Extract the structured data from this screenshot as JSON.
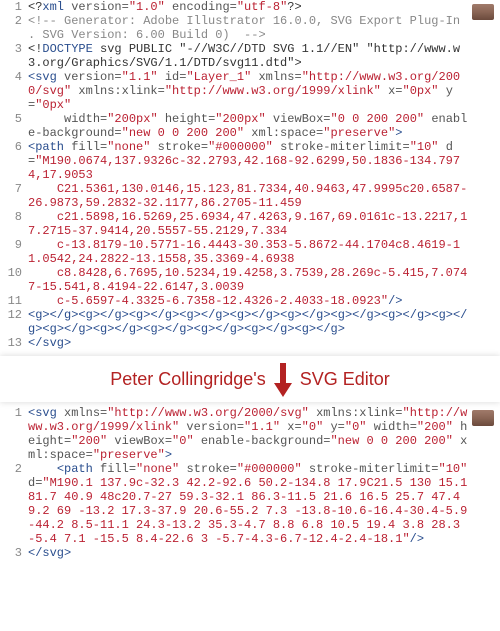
{
  "top": {
    "lines": [
      {
        "n": 1,
        "seg": [
          {
            "t": "<?",
            "c": "c-text"
          },
          {
            "t": "xml",
            "c": "c-tag"
          },
          {
            "t": " version=",
            "c": "c-attr"
          },
          {
            "t": "\"1.0\"",
            "c": "c-str"
          },
          {
            "t": " encoding=",
            "c": "c-attr"
          },
          {
            "t": "\"utf-8\"",
            "c": "c-str"
          },
          {
            "t": "?> ",
            "c": "c-text"
          }
        ]
      },
      {
        "n": 2,
        "seg": [
          {
            "t": "<!-- Generator: Adobe Illustrator 16.0.0, SVG Export Plug-In . SVG Version: 6.00 Build 0)  -->",
            "c": "c-gray"
          }
        ]
      },
      {
        "n": 3,
        "seg": [
          {
            "t": "<!",
            "c": "c-text"
          },
          {
            "t": "DOCTYPE",
            "c": "c-tag"
          },
          {
            "t": " svg PUBLIC \"-//W3C//DTD SVG 1.1//EN\" \"http://www.w3.org/Graphics/SVG/1.1/DTD/svg11.dtd\"",
            "c": "c-text"
          },
          {
            "t": ">",
            "c": "c-text"
          }
        ]
      },
      {
        "n": 4,
        "seg": [
          {
            "t": "<",
            "c": "c-tag"
          },
          {
            "t": "svg",
            "c": "c-tag"
          },
          {
            "t": " version=",
            "c": "c-attr"
          },
          {
            "t": "\"1.1\"",
            "c": "c-str"
          },
          {
            "t": " id=",
            "c": "c-attr"
          },
          {
            "t": "\"Layer_1\"",
            "c": "c-str"
          },
          {
            "t": " xmlns=",
            "c": "c-attr"
          },
          {
            "t": "\"http://www.w3.org/2000/svg\"",
            "c": "c-str"
          },
          {
            "t": " xmlns:xlink=",
            "c": "c-attr"
          },
          {
            "t": "\"http://www.w3.org/1999/xlink\"",
            "c": "c-str"
          },
          {
            "t": " x=",
            "c": "c-attr"
          },
          {
            "t": "\"0px\"",
            "c": "c-str"
          },
          {
            "t": " y=",
            "c": "c-attr"
          },
          {
            "t": "\"0px\"",
            "c": "c-str"
          }
        ]
      },
      {
        "n": 5,
        "seg": [
          {
            "t": "     width=",
            "c": "c-attr"
          },
          {
            "t": "\"200px\"",
            "c": "c-str"
          },
          {
            "t": " height=",
            "c": "c-attr"
          },
          {
            "t": "\"200px\"",
            "c": "c-str"
          },
          {
            "t": " viewBox=",
            "c": "c-attr"
          },
          {
            "t": "\"0 0 200 200\"",
            "c": "c-str"
          },
          {
            "t": " enable-background=",
            "c": "c-attr"
          },
          {
            "t": "\"new 0 0 200 200\"",
            "c": "c-str"
          },
          {
            "t": " xml:space=",
            "c": "c-attr"
          },
          {
            "t": "\"preserve\"",
            "c": "c-str"
          },
          {
            "t": ">",
            "c": "c-tag"
          }
        ]
      },
      {
        "n": 6,
        "seg": [
          {
            "t": "<",
            "c": "c-tag"
          },
          {
            "t": "path",
            "c": "c-tag"
          },
          {
            "t": " fill=",
            "c": "c-attr"
          },
          {
            "t": "\"none\"",
            "c": "c-str"
          },
          {
            "t": " stroke=",
            "c": "c-attr"
          },
          {
            "t": "\"#000000\"",
            "c": "c-str"
          },
          {
            "t": " stroke-miterlimit=",
            "c": "c-attr"
          },
          {
            "t": "\"10\"",
            "c": "c-str"
          },
          {
            "t": " d=",
            "c": "c-attr"
          },
          {
            "t": "\"M190.0674,137.9326c-32.2793,42.168-92.6299,50.1836-134.7974,17.9053",
            "c": "c-str"
          }
        ]
      },
      {
        "n": 7,
        "seg": [
          {
            "t": "    C21.5361,130.0146,15.123,81.7334,40.9463,47.9995c20.6587-26.9873,59.2832-32.1177,86.2705-11.459",
            "c": "c-str"
          }
        ]
      },
      {
        "n": 8,
        "seg": [
          {
            "t": "    c21.5898,16.5269,25.6934,47.4263,9.167,69.0161c-13.2217,17.2715-37.9414,20.5557-55.2129,7.334",
            "c": "c-str"
          }
        ]
      },
      {
        "n": 9,
        "seg": [
          {
            "t": "    c-13.8179-10.5771-16.4443-30.353-5.8672-44.1704c8.4619-11.0542,24.2822-13.1558,35.3369-4.6938",
            "c": "c-str"
          }
        ]
      },
      {
        "n": 10,
        "seg": [
          {
            "t": "    c8.8428,6.7695,10.5234,19.4258,3.7539,28.269c-5.415,7.0747-15.541,8.4194-22.6147,3.0039",
            "c": "c-str"
          }
        ]
      },
      {
        "n": 11,
        "seg": [
          {
            "t": "    c-5.6597-4.3325-6.7358-12.4326-2.4033-18.0923\"",
            "c": "c-str"
          },
          {
            "t": "/>",
            "c": "c-tag"
          }
        ]
      },
      {
        "n": 12,
        "seg": [
          {
            "t": "<",
            "c": "c-tag"
          },
          {
            "t": "g",
            "c": "c-tag"
          },
          {
            "t": "></",
            "c": "c-tag"
          },
          {
            "t": "g",
            "c": "c-tag"
          },
          {
            "t": "><",
            "c": "c-tag"
          },
          {
            "t": "g",
            "c": "c-tag"
          },
          {
            "t": "></",
            "c": "c-tag"
          },
          {
            "t": "g",
            "c": "c-tag"
          },
          {
            "t": "><",
            "c": "c-tag"
          },
          {
            "t": "g",
            "c": "c-tag"
          },
          {
            "t": "></",
            "c": "c-tag"
          },
          {
            "t": "g",
            "c": "c-tag"
          },
          {
            "t": "><",
            "c": "c-tag"
          },
          {
            "t": "g",
            "c": "c-tag"
          },
          {
            "t": "></",
            "c": "c-tag"
          },
          {
            "t": "g",
            "c": "c-tag"
          },
          {
            "t": "><",
            "c": "c-tag"
          },
          {
            "t": "g",
            "c": "c-tag"
          },
          {
            "t": "></",
            "c": "c-tag"
          },
          {
            "t": "g",
            "c": "c-tag"
          },
          {
            "t": "><",
            "c": "c-tag"
          },
          {
            "t": "g",
            "c": "c-tag"
          },
          {
            "t": "></",
            "c": "c-tag"
          },
          {
            "t": "g",
            "c": "c-tag"
          },
          {
            "t": "><",
            "c": "c-tag"
          },
          {
            "t": "g",
            "c": "c-tag"
          },
          {
            "t": "></",
            "c": "c-tag"
          },
          {
            "t": "g",
            "c": "c-tag"
          },
          {
            "t": "><",
            "c": "c-tag"
          },
          {
            "t": "g",
            "c": "c-tag"
          },
          {
            "t": "></",
            "c": "c-tag"
          },
          {
            "t": "g",
            "c": "c-tag"
          },
          {
            "t": "><",
            "c": "c-tag"
          },
          {
            "t": "g",
            "c": "c-tag"
          },
          {
            "t": "></",
            "c": "c-tag"
          },
          {
            "t": "g",
            "c": "c-tag"
          },
          {
            "t": "><",
            "c": "c-tag"
          },
          {
            "t": "g",
            "c": "c-tag"
          },
          {
            "t": "></",
            "c": "c-tag"
          },
          {
            "t": "g",
            "c": "c-tag"
          },
          {
            "t": "><",
            "c": "c-tag"
          },
          {
            "t": "g",
            "c": "c-tag"
          },
          {
            "t": "></",
            "c": "c-tag"
          },
          {
            "t": "g",
            "c": "c-tag"
          },
          {
            "t": "><",
            "c": "c-tag"
          },
          {
            "t": "g",
            "c": "c-tag"
          },
          {
            "t": "></",
            "c": "c-tag"
          },
          {
            "t": "g",
            "c": "c-tag"
          },
          {
            "t": "><",
            "c": "c-tag"
          },
          {
            "t": "g",
            "c": "c-tag"
          },
          {
            "t": "></",
            "c": "c-tag"
          },
          {
            "t": "g",
            "c": "c-tag"
          },
          {
            "t": "><",
            "c": "c-tag"
          },
          {
            "t": "g",
            "c": "c-tag"
          },
          {
            "t": "></",
            "c": "c-tag"
          },
          {
            "t": "g",
            "c": "c-tag"
          },
          {
            "t": "><",
            "c": "c-tag"
          },
          {
            "t": "g",
            "c": "c-tag"
          },
          {
            "t": "></",
            "c": "c-tag"
          },
          {
            "t": "g",
            "c": "c-tag"
          },
          {
            "t": ">",
            "c": "c-tag"
          }
        ]
      },
      {
        "n": 13,
        "seg": [
          {
            "t": "</",
            "c": "c-tag"
          },
          {
            "t": "svg",
            "c": "c-tag"
          },
          {
            "t": ">",
            "c": "c-tag"
          }
        ]
      }
    ]
  },
  "separator": {
    "left": "Peter Collingridge's",
    "right": "SVG Editor"
  },
  "bottom": {
    "lines": [
      {
        "n": 1,
        "seg": [
          {
            "t": "<",
            "c": "c-tag"
          },
          {
            "t": "svg",
            "c": "c-tag"
          },
          {
            "t": " xmlns=",
            "c": "c-attr"
          },
          {
            "t": "\"http://www.w3.org/2000/svg\"",
            "c": "c-str"
          },
          {
            "t": " xmlns:xlink=",
            "c": "c-attr"
          },
          {
            "t": "\"http://www.w3.org/1999/xlink\"",
            "c": "c-str"
          },
          {
            "t": " version=",
            "c": "c-attr"
          },
          {
            "t": "\"1.1\"",
            "c": "c-str"
          },
          {
            "t": " x=",
            "c": "c-attr"
          },
          {
            "t": "\"0\"",
            "c": "c-str"
          },
          {
            "t": " y=",
            "c": "c-attr"
          },
          {
            "t": "\"0\"",
            "c": "c-str"
          },
          {
            "t": " width=",
            "c": "c-attr"
          },
          {
            "t": "\"200\"",
            "c": "c-str"
          },
          {
            "t": " height=",
            "c": "c-attr"
          },
          {
            "t": "\"200\"",
            "c": "c-str"
          },
          {
            "t": " viewBox=",
            "c": "c-attr"
          },
          {
            "t": "\"0\"",
            "c": "c-str"
          },
          {
            "t": " enable-background=",
            "c": "c-attr"
          },
          {
            "t": "\"new 0 0 200 200\"",
            "c": "c-str"
          },
          {
            "t": " xml:space=",
            "c": "c-attr"
          },
          {
            "t": "\"preserve\"",
            "c": "c-str"
          },
          {
            "t": ">",
            "c": "c-tag"
          }
        ]
      },
      {
        "n": 2,
        "seg": [
          {
            "t": "    <",
            "c": "c-tag"
          },
          {
            "t": "path",
            "c": "c-tag"
          },
          {
            "t": " fill=",
            "c": "c-attr"
          },
          {
            "t": "\"none\"",
            "c": "c-str"
          },
          {
            "t": " stroke=",
            "c": "c-attr"
          },
          {
            "t": "\"#000000\"",
            "c": "c-str"
          },
          {
            "t": " stroke-miterlimit=",
            "c": "c-attr"
          },
          {
            "t": "\"10\"",
            "c": "c-str"
          },
          {
            "t": " d=",
            "c": "c-attr"
          },
          {
            "t": "\"M190.1 137.9c-32.3 42.2-92.6 50.2-134.8 17.9C21.5 130 15.1 81.7 40.9 48c20.7-27 59.3-32.1 86.3-11.5 21.6 16.5 25.7 47.4 9.2 69 -13.2 17.3-37.9 20.6-55.2 7.3 -13.8-10.6-16.4-30.4-5.9-44.2 8.5-11.1 24.3-13.2 35.3-4.7 8.8 6.8 10.5 19.4 3.8 28.3 -5.4 7.1 -15.5 8.4-22.6 3 -5.7-4.3-6.7-12.4-2.4-18.1\"",
            "c": "c-str"
          },
          {
            "t": "/>",
            "c": "c-tag"
          }
        ]
      },
      {
        "n": 3,
        "seg": [
          {
            "t": "</",
            "c": "c-tag"
          },
          {
            "t": "svg",
            "c": "c-tag"
          },
          {
            "t": ">",
            "c": "c-tag"
          }
        ]
      }
    ]
  }
}
